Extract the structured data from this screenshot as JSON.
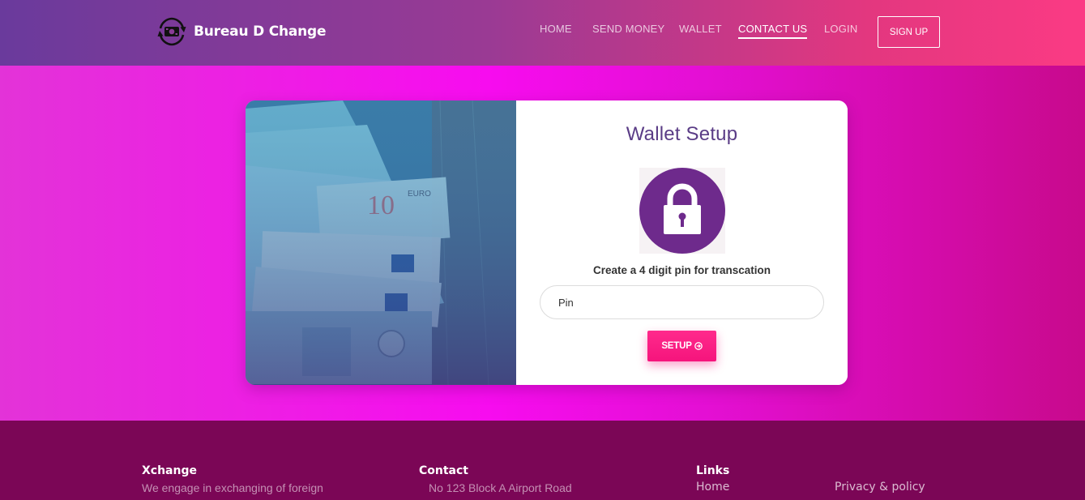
{
  "header": {
    "brand_name": "Bureau D Change",
    "brand_icon": "currency-exchange-icon",
    "nav": [
      {
        "label": "HOME",
        "active": false
      },
      {
        "label": "SEND MONEY",
        "active": false
      },
      {
        "label": "WALLET",
        "active": false
      },
      {
        "label": "CONTACT US",
        "active": true
      },
      {
        "label": "LOGIN",
        "active": false
      }
    ],
    "signup_label": "SIGN UP"
  },
  "card": {
    "image_icon": "euro-banknotes-image",
    "title": "Wallet Setup",
    "lock_icon": "padlock-icon",
    "caption": "Create a 4 digit pin for transcation",
    "pin_placeholder": "Pin",
    "pin_value": "",
    "setup_label": "SETUP",
    "setup_icon": "arrow-circle-right-icon"
  },
  "footer": {
    "col1": {
      "heading": "Xchange",
      "text": "We engage in exchanging of foreign"
    },
    "col2": {
      "heading": "Contact",
      "text": "No 123 Block A Airport Road"
    },
    "col3": {
      "heading": "Links",
      "link": "Home"
    },
    "col4": {
      "link": "Privacy & policy"
    }
  },
  "colors": {
    "header_gradient_start": "#6a3a9c",
    "header_gradient_end": "#fb3a84",
    "page_background": "#f70cef",
    "card_title": "#5a3c86",
    "lock_circle": "#6e2a8c",
    "setup_button": "#f5147c",
    "footer_background": "#7b0656"
  }
}
